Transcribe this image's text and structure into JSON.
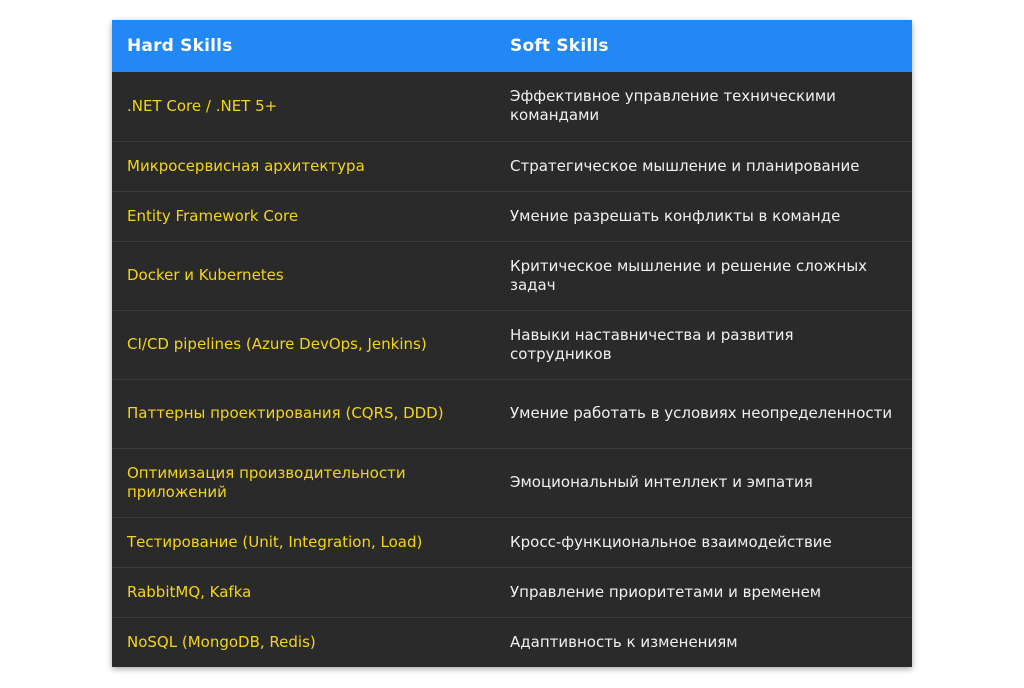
{
  "colors": {
    "header_bg": "#2288f5",
    "row_bg": "#2a2a2a",
    "hard_text": "#f2d51a",
    "soft_text": "#f0f0f0"
  },
  "table": {
    "headers": {
      "hard": "Hard Skills",
      "soft": "Soft Skills"
    },
    "rows": [
      {
        "hard": ".NET Core / .NET 5+",
        "soft": "Эффективное управление техническими командами"
      },
      {
        "hard": "Микросервисная архитектура",
        "soft": "Стратегическое мышление и планирование"
      },
      {
        "hard": "Entity Framework Core",
        "soft": "Умение разрешать конфликты в команде"
      },
      {
        "hard": "Docker и Kubernetes",
        "soft": "Критическое мышление и решение сложных задач"
      },
      {
        "hard": "CI/CD pipelines (Azure DevOps, Jenkins)",
        "soft": "Навыки наставничества и развития сотрудников"
      },
      {
        "hard": "Паттерны проектирования (CQRS, DDD)",
        "soft": "Умение работать в условиях неопределенности"
      },
      {
        "hard": "Оптимизация производительности приложений",
        "soft": "Эмоциональный интеллект и эмпатия"
      },
      {
        "hard": "Тестирование (Unit, Integration, Load)",
        "soft": "Кросс-функциональное взаимодействие"
      },
      {
        "hard": "RabbitMQ, Kafka",
        "soft": "Управление приоритетами и временем"
      },
      {
        "hard": "NoSQL (MongoDB, Redis)",
        "soft": "Адаптивность к изменениям"
      }
    ]
  }
}
